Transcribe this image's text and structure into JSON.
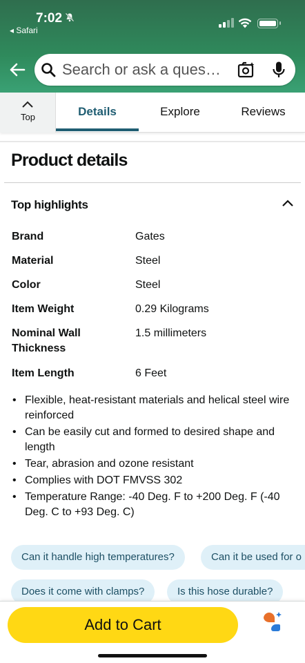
{
  "status_bar": {
    "time": "7:02",
    "back_app": "◂ Safari"
  },
  "header": {
    "search_placeholder": "Search or ask a ques…"
  },
  "tabs": {
    "top_label": "Top",
    "items": [
      {
        "label": "Details",
        "active": true
      },
      {
        "label": "Explore",
        "active": false
      },
      {
        "label": "Reviews",
        "active": false
      }
    ]
  },
  "product_details": {
    "title": "Product details",
    "highlights_title": "Top highlights",
    "specs": [
      {
        "key": "Brand",
        "value": "Gates"
      },
      {
        "key": "Material",
        "value": "Steel"
      },
      {
        "key": "Color",
        "value": "Steel"
      },
      {
        "key": "Item Weight",
        "value": "0.29 Kilograms"
      },
      {
        "key": "Nominal Wall Thickness",
        "value": "1.5 millimeters"
      },
      {
        "key": "Item Length",
        "value": "6 Feet"
      }
    ],
    "bullets": [
      "Flexible, heat-resistant materials and helical steel wire reinforced",
      "Can be easily cut and formed to desired shape and length",
      "Tear, abrasion and ozone resistant",
      "Complies with DOT FMVSS 302",
      "Temperature Range: -40 Deg. F to +200 Deg. F (-40 Deg. C to +93 Deg. C)"
    ]
  },
  "questions": [
    "Can it handle high temperatures?",
    "Can it be used for o",
    "Does it come with clamps?",
    "Is this hose durable?"
  ],
  "bottom_bar": {
    "add_to_cart": "Add to Cart"
  },
  "colors": {
    "header_green": "#2f8a5c",
    "active_tab": "#1f5d72",
    "cart_button": "#ffd814",
    "chip_bg": "#dff0f8"
  }
}
